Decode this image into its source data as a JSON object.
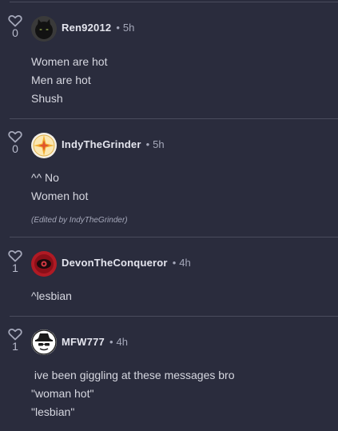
{
  "comments": [
    {
      "votes": "0",
      "username": "Ren92012",
      "time": "5h",
      "lines": [
        "Women are hot",
        "Men are hot",
        "Shush"
      ],
      "edited": ""
    },
    {
      "votes": "0",
      "username": "IndyTheGrinder",
      "time": "5h",
      "lines": [
        "^^ No",
        "Women hot"
      ],
      "edited": "(Edited by IndyTheGrinder)"
    },
    {
      "votes": "1",
      "username": "DevonTheConqueror",
      "time": "4h",
      "lines": [
        "^lesbian"
      ],
      "edited": ""
    },
    {
      "votes": "1",
      "username": "MFW777",
      "time": "4h",
      "lines": [
        " ive been giggling at these messages bro",
        "\"woman hot\"",
        "\"lesbian\""
      ],
      "edited": ""
    }
  ],
  "separator": "•",
  "icons": {
    "like": "heart-outline-icon",
    "avatar_1": "black-cat-avatar",
    "avatar_2": "yellow-star-avatar",
    "avatar_3": "red-eye-avatar",
    "avatar_4": "spy-hat-avatar"
  }
}
